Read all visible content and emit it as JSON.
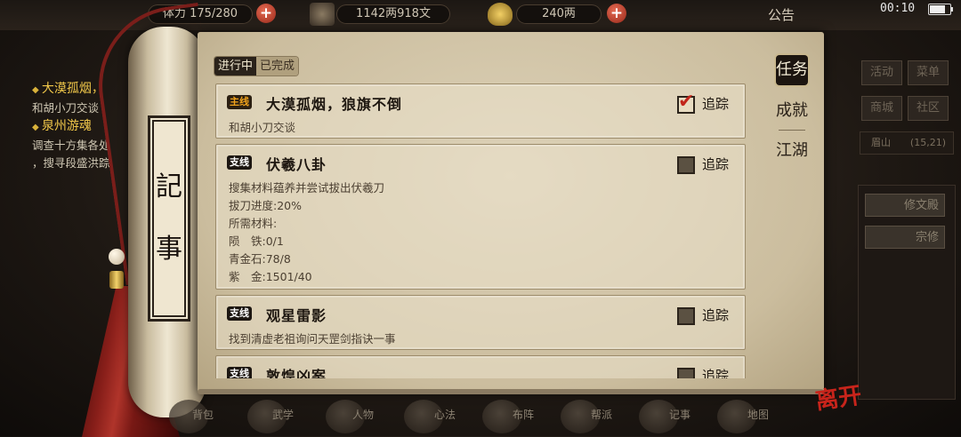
{
  "topbar": {
    "stamina_label": "体力",
    "stamina_value": "175/280",
    "coins_value": "1142两918文",
    "gold_value": "240两",
    "notice_label": "公告",
    "clock": "00:10",
    "battery_level": 0.85
  },
  "background_log": {
    "entries": [
      {
        "title": "大漠孤烟，",
        "sub": "和胡小刀交谈"
      },
      {
        "title": "泉州游魂",
        "sub": "调查十方集各处"
      },
      {
        "title": "",
        "sub": "，搜寻段盛洪踪"
      }
    ]
  },
  "scroll": {
    "label_top": "記",
    "label_bottom": "事"
  },
  "status_toggle": {
    "in_progress": "进行中",
    "completed": "已完成"
  },
  "quests": [
    {
      "tag": "主线",
      "title": "大漠孤烟，狼旗不倒",
      "tracked": true,
      "track_label": "追踪",
      "lines": [
        "和胡小刀交谈"
      ]
    },
    {
      "tag": "支线",
      "title": "伏羲八卦",
      "tracked": false,
      "track_label": "追踪",
      "lines": [
        "搜集材料蕴养并尝试拔出伏羲刀",
        "拔刀进度:20%",
        "所需材料:",
        "陨　铁:0/1",
        "青金石:78/8",
        "紫　金:1501/40"
      ]
    },
    {
      "tag": "支线",
      "title": "观星雷影",
      "tracked": false,
      "track_label": "追踪",
      "lines": [
        "找到清虚老祖询问天罡剑指诀一事"
      ]
    },
    {
      "tag": "支线",
      "title": "敦煌凶案",
      "tracked": false,
      "track_label": "追踪",
      "lines": []
    }
  ],
  "right_tabs": [
    {
      "label": "任务",
      "active": true
    },
    {
      "label": "成就",
      "active": false
    },
    {
      "label": "江湖",
      "active": false
    }
  ],
  "right_panel": {
    "buttons": [
      "活动",
      "菜单",
      "商城",
      "社区"
    ],
    "location_name": "眉山",
    "location_coords": "(15,21)",
    "items": [
      "修文殿",
      "宗修"
    ],
    "exit_label": "离开"
  },
  "bottom_menu": [
    "背包",
    "武学",
    "人物",
    "心法",
    "布阵",
    "帮派",
    "记事",
    "地图"
  ],
  "colors": {
    "main_tag": "#f0a21c",
    "check_mark": "#c2261b",
    "paper": "#d8cdb2"
  }
}
